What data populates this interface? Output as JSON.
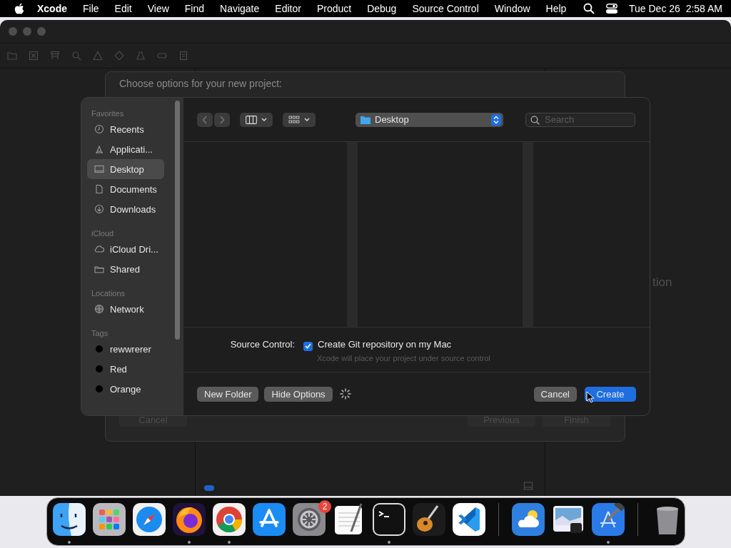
{
  "menu_bar": {
    "app": "Xcode",
    "items": [
      "File",
      "Edit",
      "View",
      "Find",
      "Navigate",
      "Editor",
      "Product",
      "Debug",
      "Source Control",
      "Window",
      "Help"
    ],
    "clock": "Tue Dec 26  2:58 AM"
  },
  "background_sheet": {
    "title": "Choose options for your new project:",
    "buttons": [
      "Cancel",
      "Previous",
      "Finish"
    ],
    "partial_text": "tion"
  },
  "save_panel": {
    "sidebar": [
      {
        "heading": "Favorites",
        "items": [
          {
            "label": "Recents",
            "kind": "clock",
            "selected": false
          },
          {
            "label": "Applicati...",
            "kind": "apps",
            "selected": false
          },
          {
            "label": "Desktop",
            "kind": "desktop",
            "selected": true
          },
          {
            "label": "Documents",
            "kind": "document",
            "selected": false
          },
          {
            "label": "Downloads",
            "kind": "download",
            "selected": false
          }
        ]
      },
      {
        "heading": "iCloud",
        "items": [
          {
            "label": "iCloud Dri...",
            "kind": "cloud",
            "selected": false
          },
          {
            "label": "Shared",
            "kind": "shared",
            "selected": false
          }
        ]
      },
      {
        "heading": "Locations",
        "items": [
          {
            "label": "Network",
            "kind": "globe",
            "selected": false
          }
        ]
      },
      {
        "heading": "Tags",
        "items": [
          {
            "label": "rewwrerer",
            "kind": "tag",
            "selected": false
          },
          {
            "label": "Red",
            "kind": "tag",
            "selected": false
          },
          {
            "label": "Orange",
            "kind": "tag",
            "selected": false
          }
        ]
      }
    ],
    "location": "Desktop",
    "search": {
      "placeholder": "Search"
    },
    "source_control": {
      "label": "Source Control:",
      "checkbox_label": "Create Git repository on my Mac",
      "checked": true,
      "hint": "Xcode will place your project under source control"
    },
    "buttons": [
      {
        "label": "New Folder",
        "kind": "plain"
      },
      {
        "label": "Hide Options",
        "kind": "plain"
      },
      {
        "label": "Cancel",
        "kind": "plain"
      },
      {
        "label": "Create",
        "kind": "default"
      }
    ]
  },
  "dock": {
    "items": [
      {
        "kind": "finder",
        "running": true
      },
      {
        "kind": "launchpad",
        "running": false
      },
      {
        "kind": "safari",
        "running": false
      },
      {
        "kind": "firefox",
        "running": true
      },
      {
        "kind": "chrome",
        "running": true
      },
      {
        "kind": "appstore",
        "running": false
      },
      {
        "kind": "settings",
        "running": false,
        "badge": "2"
      },
      {
        "kind": "textedit",
        "running": false
      },
      {
        "kind": "terminal",
        "running": true
      },
      {
        "kind": "garageband",
        "running": false
      },
      {
        "kind": "vscode",
        "running": false
      },
      {
        "kind": "separator"
      },
      {
        "kind": "weather",
        "running": false
      },
      {
        "kind": "preview",
        "running": false
      },
      {
        "kind": "xcode",
        "running": true
      },
      {
        "kind": "separator"
      },
      {
        "kind": "trash",
        "running": false
      }
    ]
  }
}
